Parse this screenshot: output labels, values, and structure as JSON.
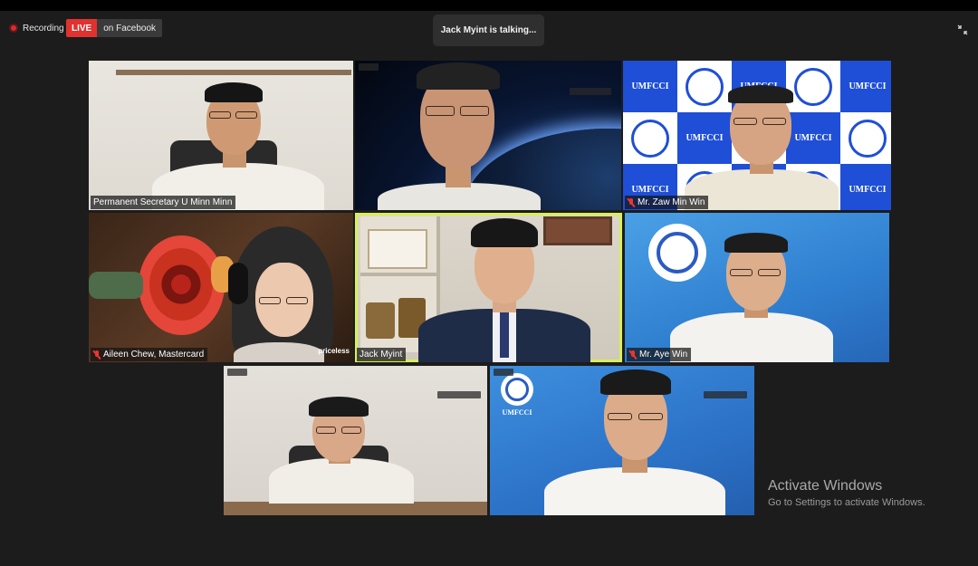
{
  "toolbar": {
    "recording_label": "Recording",
    "live_label": "LIVE",
    "live_target": "on Facebook",
    "talking_indicator": "Jack Myint is talking...",
    "exit_fullscreen_icon": "exit-fullscreen-icon"
  },
  "participants": [
    {
      "name": "Permanent Secretary U Minn Minn",
      "muted": false
    },
    {
      "name": "",
      "muted": false
    },
    {
      "name": "Mr. Zaw Min Win",
      "muted": true
    },
    {
      "name": "Aileen Chew, Mastercard",
      "muted": true
    },
    {
      "name": "Jack Myint",
      "muted": false,
      "active_speaker": true
    },
    {
      "name": "Mr. Aye Win",
      "muted": true
    },
    {
      "name": "",
      "muted": false
    },
    {
      "name": "",
      "muted": false
    }
  ],
  "backgrounds": {
    "logo_text": "UMFCCI",
    "priceless_text": "priceless"
  },
  "watermark": {
    "title": "Activate Windows",
    "subtitle": "Go to Settings to activate Windows."
  },
  "colors": {
    "live_red": "#e0322e",
    "active_outline": "#d9ef5a",
    "umfcci_blue": "#1f4fd6"
  }
}
